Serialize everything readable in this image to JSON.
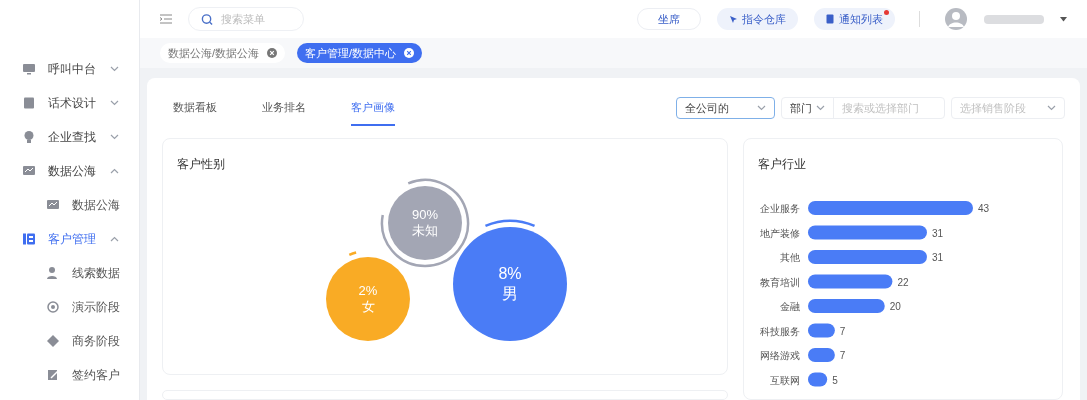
{
  "header": {
    "search": {
      "placeholder": "搜索菜单"
    },
    "buttons": [
      {
        "kind": "plain",
        "label": "坐席",
        "badge": false
      },
      {
        "kind": "command",
        "label": "指令仓库",
        "badge": false
      },
      {
        "kind": "notice",
        "label": "通知列表",
        "badge": true
      }
    ]
  },
  "sidebar": {
    "items": [
      {
        "label": "呼叫中台",
        "expanded": false,
        "selected": false
      },
      {
        "label": "话术设计",
        "expanded": false,
        "selected": false
      },
      {
        "label": "企业查找",
        "expanded": false,
        "selected": false
      },
      {
        "label": "数据公海",
        "expanded": true,
        "selected": false,
        "children": [
          {
            "label": "数据公海",
            "selected": false
          }
        ]
      },
      {
        "label": "客户管理",
        "expanded": true,
        "selected": true,
        "children": [
          {
            "label": "线索数据",
            "selected": false
          },
          {
            "label": "演示阶段",
            "selected": false
          },
          {
            "label": "商务阶段",
            "selected": false
          },
          {
            "label": "签约客户",
            "selected": false
          }
        ]
      }
    ]
  },
  "page_tabs": [
    {
      "label": "数据公海/数据公海",
      "selected": false
    },
    {
      "label": "客户管理/数据中心",
      "selected": true
    }
  ],
  "tabs": [
    {
      "label": "数据看板",
      "selected": false
    },
    {
      "label": "业务排名",
      "selected": false
    },
    {
      "label": "客户画像",
      "selected": true
    }
  ],
  "filters": {
    "scope": {
      "value": "全公司的"
    },
    "department": {
      "label": "部门",
      "placeholder": "搜索或选择部门"
    },
    "stage": {
      "placeholder": "选择销售阶段"
    }
  },
  "gender_panel": {
    "title": "客户性别",
    "bubbles": [
      {
        "percent": "90%",
        "label": "未知",
        "color": "#a3a6b4"
      },
      {
        "percent": "2%",
        "label": "女",
        "color": "#f9ab25"
      },
      {
        "percent": "8%",
        "label": "男",
        "color": "#4a7cf6"
      }
    ]
  },
  "industry_panel": {
    "title": "客户行业",
    "chart_data": {
      "type": "bar",
      "orientation": "horizontal",
      "data_labels": true,
      "categories": [
        "企业服务",
        "地产装修",
        "其他",
        "教育培训",
        "金融",
        "科技服务",
        "网络游戏",
        "互联网"
      ],
      "series": [
        {
          "color": "#4a7cf6",
          "values": [
            43,
            31,
            31,
            22,
            20,
            7,
            7,
            5
          ]
        }
      ]
    }
  }
}
